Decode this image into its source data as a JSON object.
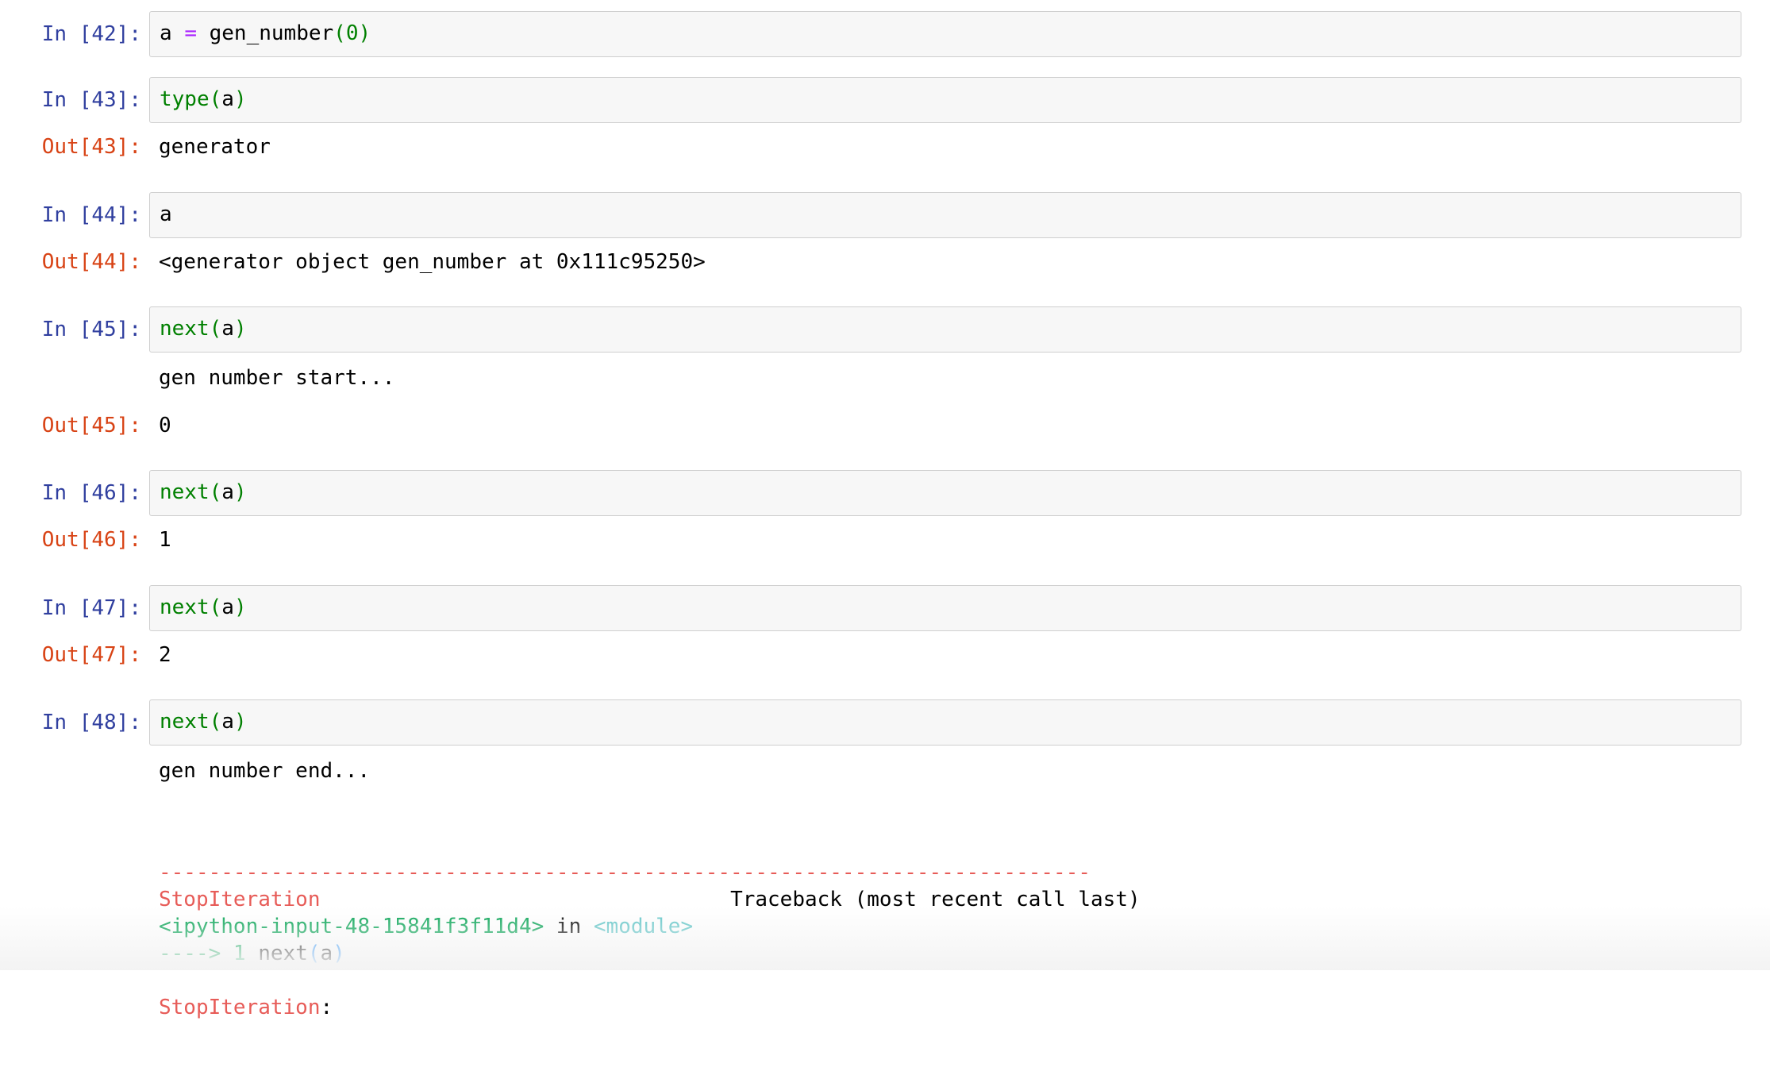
{
  "cells": [
    {
      "in_prompt": "In [42]:",
      "code": {
        "var": "a",
        "op": "=",
        "fn": "gen_number",
        "open": "(",
        "arg": "0",
        "close": ")"
      }
    },
    {
      "in_prompt": "In [43]:",
      "code": {
        "fn": "type",
        "open": "(",
        "arg": "a",
        "close": ")"
      },
      "out_prompt": "Out[43]:",
      "output": "generator"
    },
    {
      "in_prompt": "In [44]:",
      "code": {
        "text": "a"
      },
      "out_prompt": "Out[44]:",
      "output": "<generator object gen_number at 0x111c95250>"
    },
    {
      "in_prompt": "In [45]:",
      "code": {
        "fn": "next",
        "open": "(",
        "arg": "a",
        "close": ")"
      },
      "stdout": "gen number start...",
      "out_prompt": "Out[45]:",
      "output": "0"
    },
    {
      "in_prompt": "In [46]:",
      "code": {
        "fn": "next",
        "open": "(",
        "arg": "a",
        "close": ")"
      },
      "out_prompt": "Out[46]:",
      "output": "1"
    },
    {
      "in_prompt": "In [47]:",
      "code": {
        "fn": "next",
        "open": "(",
        "arg": "a",
        "close": ")"
      },
      "out_prompt": "Out[47]:",
      "output": "2"
    },
    {
      "in_prompt": "In [48]:",
      "code": {
        "fn": "next",
        "open": "(",
        "arg": "a",
        "close": ")"
      },
      "stdout": "gen number end...",
      "traceback": {
        "separator": "---------------------------------------------------------------------------",
        "exception": "StopIteration",
        "gap": "                                 ",
        "header": "Traceback (most recent call last)",
        "source": "<ipython-input-48-15841f3f11d4>",
        "in_word": " in ",
        "module": "<module>",
        "arrow": "----> 1 ",
        "line_fn": "next",
        "line_open": "(",
        "line_arg": "a",
        "line_close": ")",
        "final_exception": "StopIteration",
        "final_colon": ":"
      }
    }
  ],
  "colors": {
    "in_prompt": "#303f9f",
    "out_prompt": "#d84315",
    "builtin": "#008000",
    "keyword_op": "#aa22ff",
    "traceback_red": "#e75c58",
    "traceback_green": "#00a250",
    "traceback_cyan": "#60c6c8",
    "input_bg": "#f7f7f7",
    "input_border": "#cfcfcf"
  }
}
